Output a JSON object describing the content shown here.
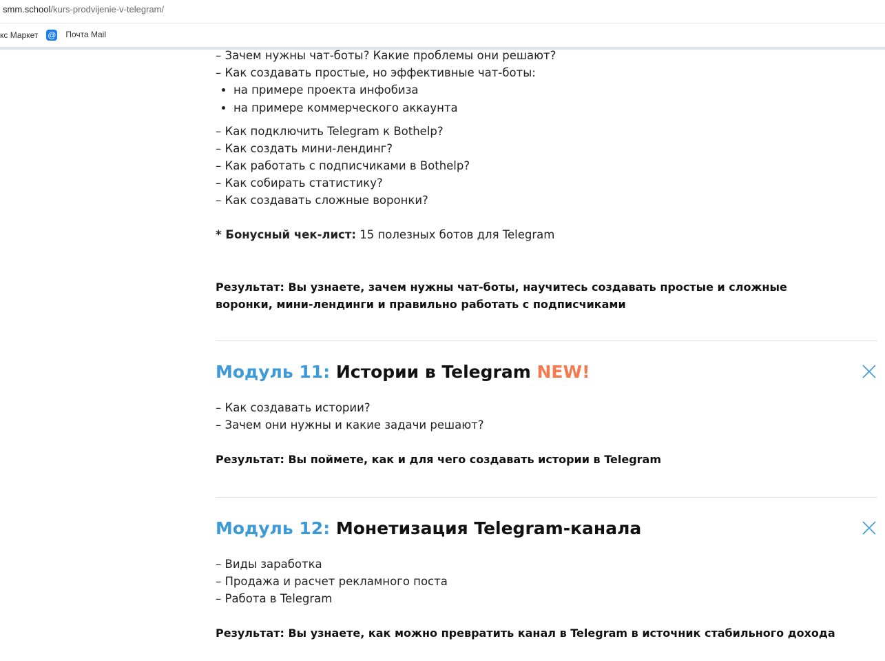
{
  "browser": {
    "url_host": "smm.school",
    "url_path": "/kurs-prodvijenie-v-telegram/",
    "bookmarks": [
      "кс Маркет",
      "Почта Mail"
    ]
  },
  "module10": {
    "lines_top": [
      "– Зачем нужны чат-боты? Какие проблемы они решают?",
      "– Как создавать простые, но эффективные чат-боты:"
    ],
    "bullets": [
      "на примере проекта инфобиза",
      "на примере коммерческого аккаунта"
    ],
    "lines": [
      "– Как подключить Telegram к Bothelp?",
      "– Как создать мини-лендинг?",
      "– Как работать с подписчиками в Bothelp?",
      "– Как собирать статистику?",
      "– Как создавать сложные воронки?"
    ],
    "bonus_label": "* Бонусный чек-лист:",
    "bonus_text": " 15 полезных ботов для Telegram",
    "result": "Результат: Вы узнаете, зачем нужны чат-боты, научитесь создавать простые и сложные воронки, мини-лендинги и правильно работать с подписчиками"
  },
  "module11": {
    "num": "Модуль 11:",
    "title": " Истории в Telegram ",
    "badge": "NEW!",
    "lines": [
      "– Как создавать истории?",
      "– Зачем они нужны и какие задачи решают?"
    ],
    "result": "Результат: Вы поймете, как и для чего создавать истории в Telegram"
  },
  "module12": {
    "num": "Модуль 12:",
    "title": " Монетизация Telegram-канала",
    "lines": [
      "– Виды заработка",
      "– Продажа и расчет рекламного поста",
      "– Работа в Telegram"
    ],
    "result": "Результат: Вы узнаете, как можно превратить канал в Telegram в источник стабильного дохода"
  },
  "colors": {
    "accent": "#3d9ad6",
    "new": "#f47b50"
  }
}
